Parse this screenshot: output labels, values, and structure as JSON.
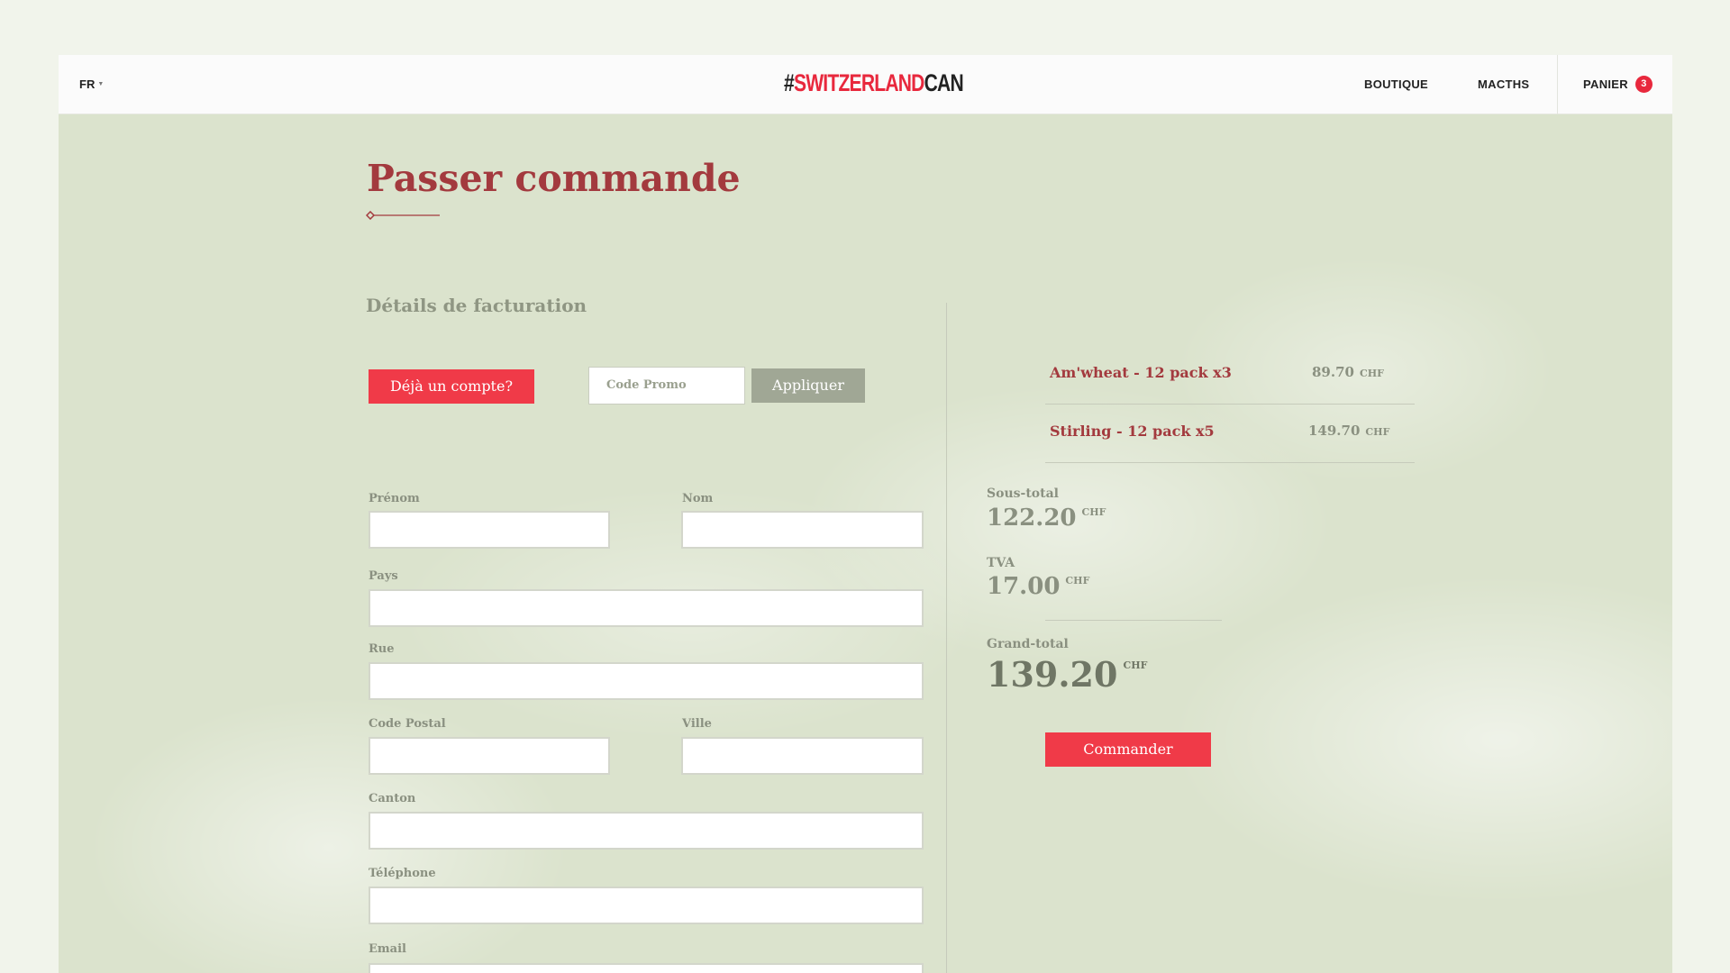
{
  "header": {
    "language": "FR",
    "logo": {
      "hash": "#",
      "part1": "SWITZERLAND",
      "part2": "CAN"
    },
    "nav": {
      "boutique": "BOUTIQUE",
      "matchs": "MACTHS",
      "panier": "PANIER",
      "cart_count": "3"
    }
  },
  "page": {
    "title": "Passer commande"
  },
  "billing": {
    "heading": "Détails de facturation",
    "account_button": "Déjà un compte?",
    "promo_placeholder": "Code Promo",
    "apply_button": "Appliquer",
    "fields": {
      "prenom": "Prénom",
      "nom": "Nom",
      "pays": "Pays",
      "rue": "Rue",
      "code_postal": "Code Postal",
      "ville": "Ville",
      "canton": "Canton",
      "telephone": "Téléphone",
      "email": "Email"
    }
  },
  "order": {
    "items": [
      {
        "name": "Am'wheat - 12 pack x3",
        "price": "89.70",
        "currency": "CHF"
      },
      {
        "name": "Stirling - 12 pack x5",
        "price": "149.70",
        "currency": "CHF"
      }
    ],
    "subtotal": {
      "label": "Sous-total",
      "value": "122.20",
      "currency": "CHF"
    },
    "tva": {
      "label": "TVA",
      "value": "17.00",
      "currency": "CHF"
    },
    "grand_total": {
      "label": "Grand-total",
      "value": "139.20",
      "currency": "CHF"
    },
    "order_button": "Commander"
  },
  "colors": {
    "brand_red": "#e8283d",
    "title_red": "#a33a3e",
    "muted_green": "#8a9080",
    "background": "#dbe3cd"
  }
}
